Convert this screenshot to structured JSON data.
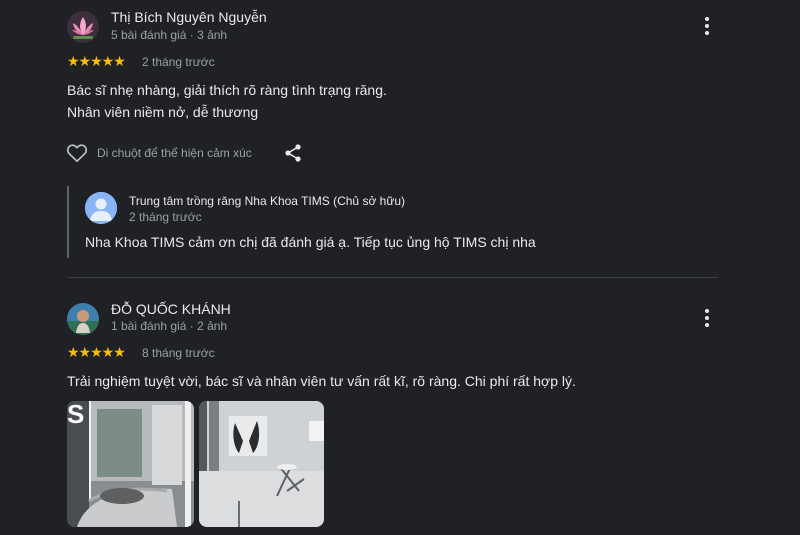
{
  "reviews": [
    {
      "author": "Thị Bích Nguyên Nguyễn",
      "meta": "5 bài đánh giá · 3 ảnh",
      "stars": "★★★★★",
      "rating": 5,
      "when": "2 tháng trước",
      "text_lines": [
        "Bác sĩ nhẹ nhàng, giải thích rõ ràng tình trạng răng.",
        "Nhân viên niềm nở, dễ thương"
      ],
      "react_label": "Di chuột để thể hiện cảm xúc",
      "reply": {
        "owner": "Trung tâm trồng răng Nha Khoa TIMS (Chủ sở hữu)",
        "when": "2 tháng trước",
        "text": "Nha Khoa TIMS cảm ơn chị đã đánh giá ạ. Tiếp tục ủng hộ TIMS chị nha"
      }
    },
    {
      "author": "ĐỖ QUỐC KHÁNH",
      "meta": "1 bài đánh giá · 2 ảnh",
      "stars": "★★★★★",
      "rating": 5,
      "when": "8 tháng trước",
      "text": "Trải nghiệm tuyệt vời, bác sĩ và nhân viên tư vấn rất kĩ, rõ ràng. Chi phí rất hợp lý.",
      "photo1_letter": "S"
    }
  ],
  "colors": {
    "star": "#fbbc04",
    "background": "#202124",
    "text": "#e8eaed",
    "muted": "#9aa0a6"
  },
  "icons": [
    "lotus-avatar-icon",
    "more-vert-icon",
    "heart-outline-icon",
    "share-icon",
    "person-avatar-icon"
  ]
}
